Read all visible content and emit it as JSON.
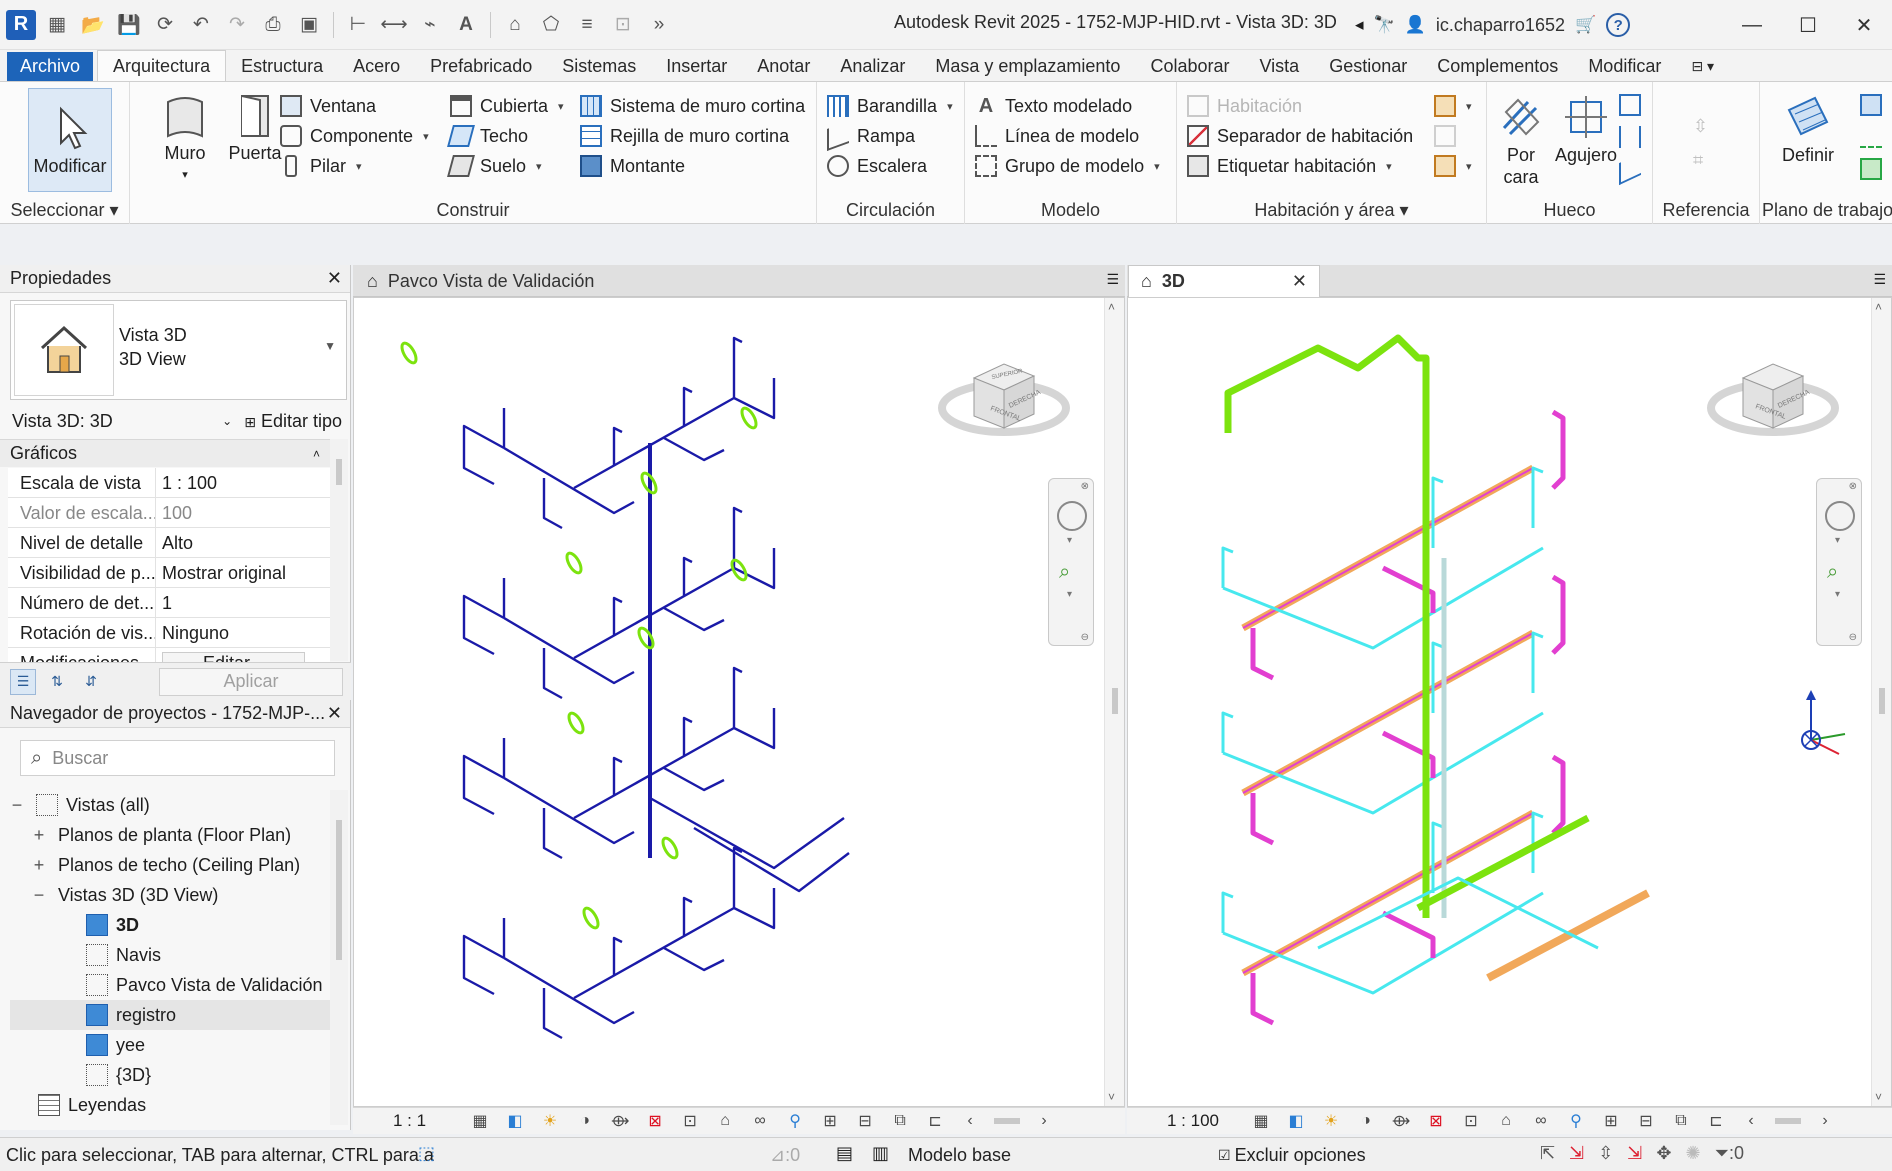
{
  "app": {
    "title": "Autodesk Revit 2025 - 1752-MJP-HID.rvt - Vista 3D: 3D",
    "user": "ic.chaparro1652",
    "logo_letter": "R"
  },
  "menu": {
    "file": "Archivo",
    "tabs": [
      "Arquitectura",
      "Estructura",
      "Acero",
      "Prefabricado",
      "Sistemas",
      "Insertar",
      "Anotar",
      "Analizar",
      "Masa y emplazamiento",
      "Colaborar",
      "Vista",
      "Gestionar",
      "Complementos",
      "Modificar"
    ],
    "active": "Arquitectura"
  },
  "ribbon": {
    "select": {
      "modify": "Modificar",
      "label": "Seleccionar"
    },
    "build": {
      "wall": "Muro",
      "door": "Puerta",
      "window": "Ventana",
      "component": "Componente",
      "column": "Pilar",
      "roof": "Cubierta",
      "ceiling": "Techo",
      "floor": "Suelo",
      "curtain_system": "Sistema de muro cortina",
      "curtain_grid": "Rejilla de muro cortina",
      "mullion": "Montante",
      "label": "Construir"
    },
    "circulation": {
      "railing": "Barandilla",
      "ramp": "Rampa",
      "stair": "Escalera",
      "label": "Circulación"
    },
    "model": {
      "model_text": "Texto modelado",
      "model_line": "Línea de modelo",
      "model_group": "Grupo de modelo",
      "label": "Modelo"
    },
    "room": {
      "room": "Habitación",
      "separator": "Separador  de habitación",
      "tag": "Etiquetar  habitación",
      "label": "Habitación y área"
    },
    "opening": {
      "by_face": "Por cara",
      "by_face_line2": "cara",
      "by_face_line1": "Por",
      "shaft": "Agujero",
      "label": "Hueco"
    },
    "datum": {
      "label": "Referencia"
    },
    "workplane": {
      "set": "Definir",
      "label": "Plano de trabajo"
    }
  },
  "properties": {
    "title": "Propiedades",
    "type_line1": "Vista 3D",
    "type_line2": "3D View",
    "instance": "Vista 3D: 3D",
    "edit_type": "Editar tipo",
    "section": "Gráficos",
    "rows": [
      {
        "key": "Escala de vista",
        "value": "1 : 100"
      },
      {
        "key": "Valor de escala...",
        "value": "100"
      },
      {
        "key": "Nivel de detalle",
        "value": "Alto"
      },
      {
        "key": "Visibilidad de p...",
        "value": "Mostrar original"
      },
      {
        "key": "Número de det...",
        "value": "1"
      },
      {
        "key": "Rotación de vis...",
        "value": "Ninguno"
      },
      {
        "key": "Modificaciones...",
        "value": "Editar..."
      }
    ],
    "apply": "Aplicar"
  },
  "browser": {
    "title": "Navegador de proyectos - 1752-MJP-...",
    "search_placeholder": "Buscar",
    "nodes": [
      {
        "mark": "−",
        "label": "Vistas (all)",
        "indent": 0
      },
      {
        "mark": "+",
        "label": "Planos de planta (Floor Plan)",
        "indent": 1
      },
      {
        "mark": "+",
        "label": "Planos de techo (Ceiling Plan)",
        "indent": 1
      },
      {
        "mark": "−",
        "label": "Vistas 3D (3D View)",
        "indent": 1
      },
      {
        "mark": "",
        "label": "3D",
        "indent": 2,
        "icon": "filled",
        "bold": true
      },
      {
        "mark": "",
        "label": "Navis",
        "indent": 2,
        "icon": "dotted"
      },
      {
        "mark": "",
        "label": "Pavco Vista de Validación",
        "indent": 2,
        "icon": "dotted"
      },
      {
        "mark": "",
        "label": "registro",
        "indent": 2,
        "icon": "filled",
        "selected": true
      },
      {
        "mark": "",
        "label": "yee",
        "indent": 2,
        "icon": "filled"
      },
      {
        "mark": "",
        "label": "{3D}",
        "indent": 2,
        "icon": "dotted"
      },
      {
        "mark": "",
        "label": "Leyendas",
        "indent": 0,
        "icon": "legend"
      }
    ]
  },
  "views": {
    "left_tab": "Pavco Vista de Validación",
    "right_tab": "3D",
    "left_scale": "1 : 1",
    "right_scale": "1 : 100",
    "cube_face_front": "FRONTAL",
    "cube_face_right": "DERECHA",
    "cube_face_top": "SUPERIOR"
  },
  "status": {
    "message": "Clic para seleccionar, TAB para alternar, CTRL para a",
    "model": "Modelo base",
    "exclude": "Excluir opciones",
    "zero_a": ":0",
    "zero_b": ":0"
  },
  "colors": {
    "accent": "#1d64b9",
    "pipe_blue": "#1a1aa8",
    "pipe_green": "#7ce30e",
    "pipe_cyan": "#47e8ee",
    "pipe_magenta": "#e23fd0",
    "pipe_orange": "#f1a85a"
  }
}
